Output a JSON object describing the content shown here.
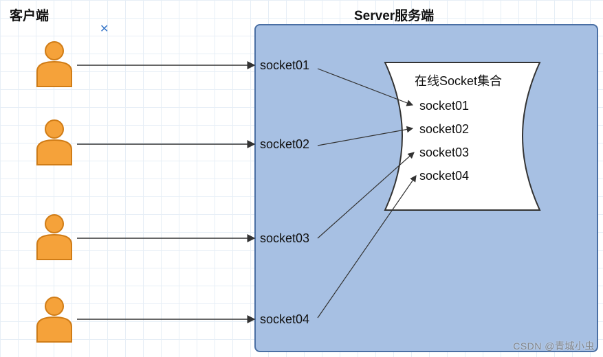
{
  "headings": {
    "client": "客户端",
    "server": "Server服务端"
  },
  "clients": [
    {
      "socket_label": "socket01"
    },
    {
      "socket_label": "socket02"
    },
    {
      "socket_label": "socket03"
    },
    {
      "socket_label": "socket04"
    }
  ],
  "collection": {
    "title": "在线Socket集合",
    "items": [
      "socket01",
      "socket02",
      "socket03",
      "socket04"
    ]
  },
  "watermark": "CSDN @青城小虫",
  "colors": {
    "client_fill": "#f5a23a",
    "client_stroke": "#d07c16",
    "server_fill": "#a7c0e3",
    "server_stroke": "#4a6fa4"
  },
  "chart_data": {
    "type": "diagram",
    "description": "Four clients each establish a socket connection (socket01–socket04) to a server which keeps an online-socket collection containing those same four socket entries.",
    "nodes": {
      "clients": [
        "client01",
        "client02",
        "client03",
        "client04"
      ],
      "server_sockets": [
        "socket01",
        "socket02",
        "socket03",
        "socket04"
      ],
      "collection": {
        "name": "在线Socket集合",
        "members": [
          "socket01",
          "socket02",
          "socket03",
          "socket04"
        ]
      }
    },
    "edges": [
      {
        "from": "client01",
        "to": "socket01"
      },
      {
        "from": "client02",
        "to": "socket02"
      },
      {
        "from": "client03",
        "to": "socket03"
      },
      {
        "from": "client04",
        "to": "socket04"
      },
      {
        "from": "socket01",
        "to": "collection.socket01"
      },
      {
        "from": "socket02",
        "to": "collection.socket02"
      },
      {
        "from": "socket03",
        "to": "collection.socket03"
      },
      {
        "from": "socket04",
        "to": "collection.socket04"
      }
    ]
  }
}
